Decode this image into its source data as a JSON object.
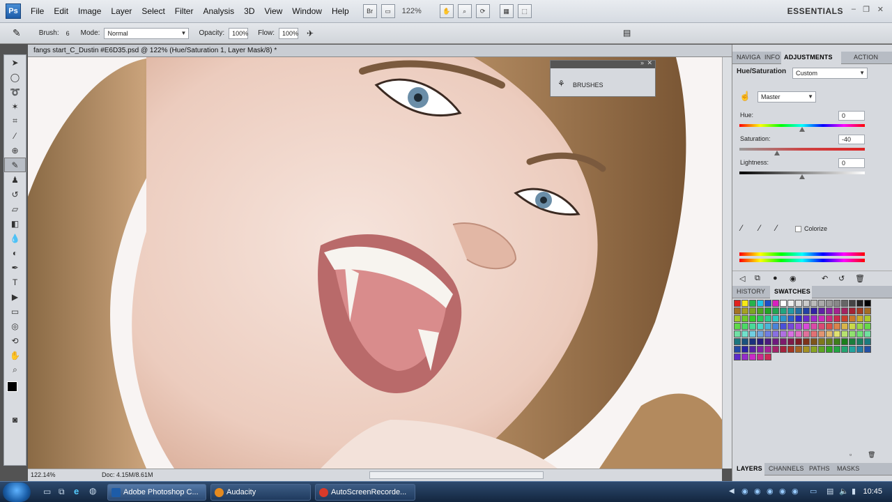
{
  "menubar": {
    "logo": "Ps",
    "items": [
      "File",
      "Edit",
      "Image",
      "Layer",
      "Select",
      "Filter",
      "Analysis",
      "3D",
      "View",
      "Window",
      "Help"
    ],
    "bridge_label": "Br",
    "zoom": "122%",
    "workspace": "ESSENTIALS"
  },
  "options": {
    "brush_label": "Brush:",
    "brush_size": "6",
    "mode_label": "Mode:",
    "mode_value": "Normal",
    "opacity_label": "Opacity:",
    "opacity_value": "100%",
    "flow_label": "Flow:",
    "flow_value": "100%"
  },
  "document": {
    "title": "fangs start_C_Dustin #E6D35.psd @ 122% (Hue/Saturation 1, Layer Mask/8) *",
    "zoom_status": "122.14%",
    "doc_size": "Doc: 4.15M/8.61M"
  },
  "brushes_panel": {
    "label": "BRUSHES"
  },
  "adjust_panel": {
    "tabs": [
      "NAVIGA",
      "INFO",
      "ADJUSTMENTS",
      "ACTION"
    ],
    "active_tab": "ADJUSTMENTS",
    "title": "Hue/Saturation",
    "preset": "Custom",
    "channel": "Master",
    "hue_label": "Hue:",
    "hue_value": "0",
    "saturation_label": "Saturation:",
    "saturation_value": "-40",
    "lightness_label": "Lightness:",
    "lightness_value": "0",
    "colorize_label": "Colorize"
  },
  "swatch_panel": {
    "tabs": [
      "HISTORY",
      "SWATCHES"
    ],
    "active_tab": "SWATCHES"
  },
  "layers_panel": {
    "tabs": [
      "LAYERS",
      "CHANNELS",
      "PATHS",
      "MASKS"
    ]
  },
  "taskbar": {
    "items": [
      "Adobe Photoshop C...",
      "Audacity",
      "AutoScreenRecorde..."
    ],
    "clock": "10:45"
  },
  "colors": {
    "accent": "#1d5ca8",
    "panel_bg": "#d6d9de"
  }
}
